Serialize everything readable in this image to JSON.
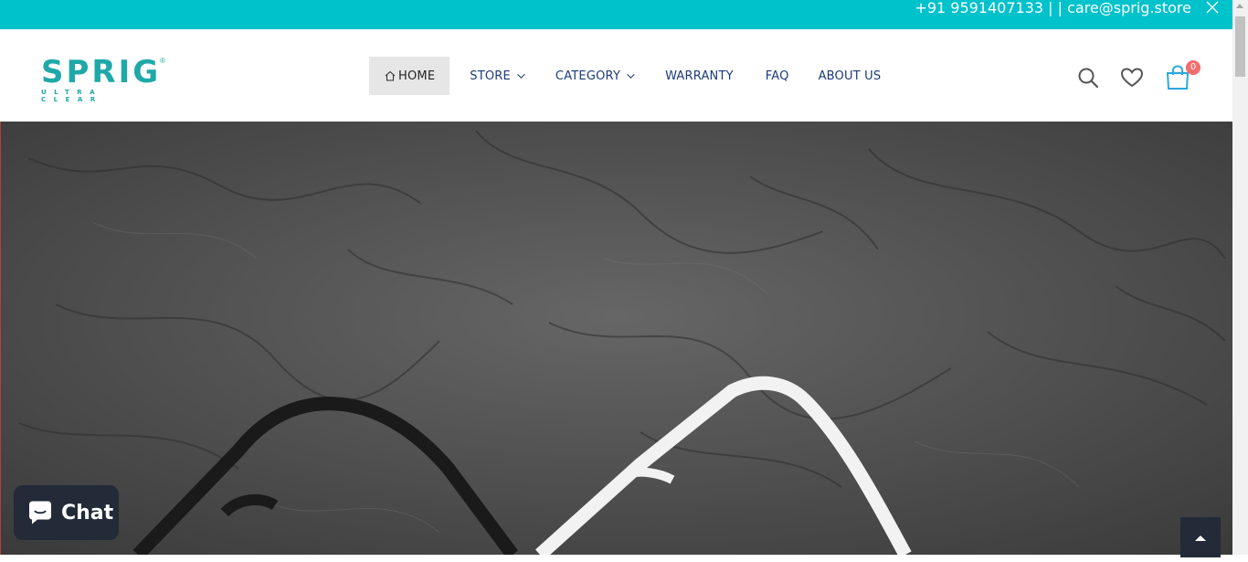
{
  "topbar": {
    "contact": "+91 9591407133 | | care@sprig.store",
    "close_icon": "close-icon"
  },
  "logo": {
    "name": "SPRIG",
    "tagline": "ULTRA CLEAR",
    "mark": "®"
  },
  "nav": {
    "items": [
      {
        "label": "HOME",
        "icon": "home-icon",
        "active": true
      },
      {
        "label": "STORE",
        "dropdown": true
      },
      {
        "label": "CATEGORY",
        "dropdown": true
      },
      {
        "label": "WARRANTY"
      },
      {
        "label": "FAQ"
      },
      {
        "label": "ABOUT US"
      }
    ]
  },
  "header_icons": [
    "search-icon",
    "heart-icon",
    "shopping-bag-icon"
  ],
  "cart": {
    "count": "0"
  },
  "chat": {
    "label": "Chat",
    "icon": "chat-bubble-icon"
  },
  "colors": {
    "topbar": "#00c2cb",
    "brand": "#1fa8a8",
    "nav_text": "#1b3a7a",
    "badge": "#f26d6d",
    "dark_button": "#222b37"
  }
}
